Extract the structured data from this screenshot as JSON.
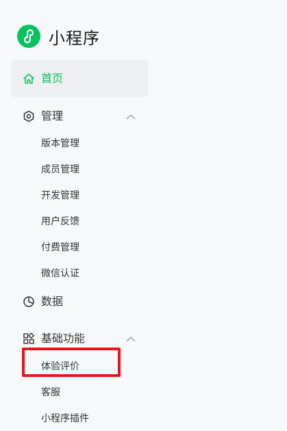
{
  "app": {
    "title": "小程序"
  },
  "nav": {
    "home": {
      "label": "首页"
    },
    "manage": {
      "label": "管理",
      "items": [
        "版本管理",
        "成员管理",
        "开发管理",
        "用户反馈",
        "付费管理",
        "微信认证"
      ]
    },
    "data": {
      "label": "数据"
    },
    "basic": {
      "label": "基础功能",
      "items": [
        "体验评价",
        "客服",
        "小程序插件"
      ]
    }
  },
  "colors": {
    "accent": "#07c160",
    "highlight": "#e8141c"
  }
}
